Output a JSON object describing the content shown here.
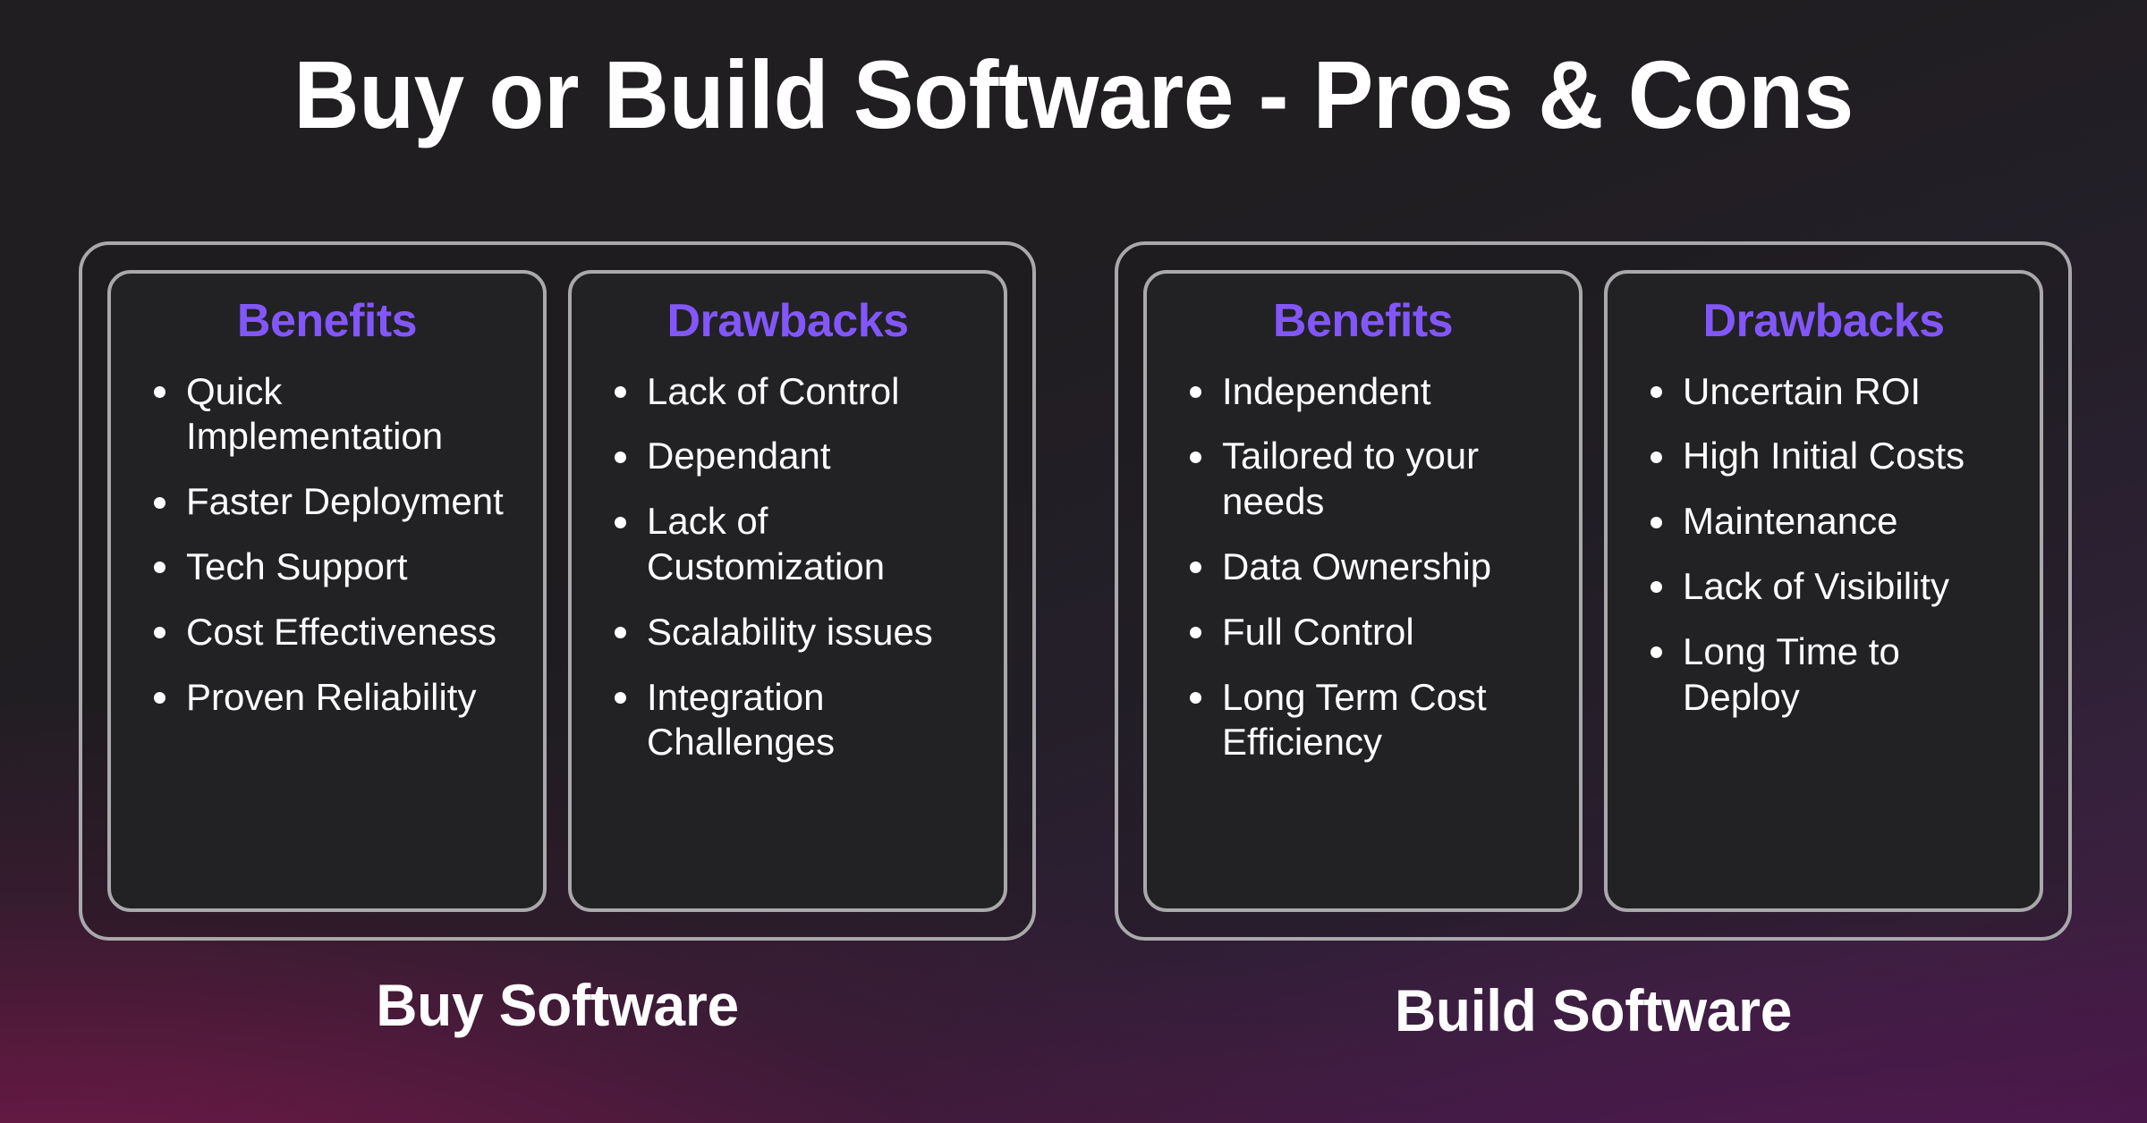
{
  "title": "Buy or Build Software - Pros & Cons",
  "theme": {
    "accent_purple": "#8257fa",
    "border_gray": "#a9a8ab",
    "card_background": "#222124",
    "text_white": "#ffffff",
    "background_top": "#201e21",
    "background_bottom_left": "#6b1a46",
    "background_bottom_right": "#4a1847"
  },
  "groups": [
    {
      "label": "Buy Software",
      "cards": [
        {
          "heading": "Benefits",
          "items": [
            "Quick Implementation",
            "Faster Deployment",
            "Tech Support",
            "Cost Effectiveness",
            "Proven Reliability"
          ]
        },
        {
          "heading": "Drawbacks",
          "items": [
            "Lack of Control",
            "Dependant",
            "Lack of Customization",
            "Scalability issues",
            "Integration Challenges"
          ]
        }
      ]
    },
    {
      "label": "Build Software",
      "cards": [
        {
          "heading": "Benefits",
          "items": [
            "Independent",
            "Tailored to your needs",
            "Data Ownership",
            "Full Control",
            "Long Term Cost Efficiency"
          ]
        },
        {
          "heading": "Drawbacks",
          "items": [
            "Uncertain ROI",
            "High Initial Costs",
            "Maintenance",
            "Lack of Visibility",
            "Long Time to Deploy"
          ]
        }
      ]
    }
  ]
}
